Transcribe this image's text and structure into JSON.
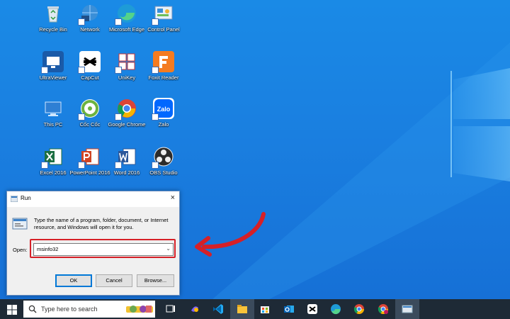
{
  "desktop": {
    "icons": [
      {
        "label": "Recycle Bin",
        "icon": "recycle-bin-icon"
      },
      {
        "label": "Network",
        "icon": "network-icon"
      },
      {
        "label": "Microsoft Edge",
        "icon": "edge-icon"
      },
      {
        "label": "Control Panel",
        "icon": "control-panel-icon"
      },
      {
        "label": "UltraViewer",
        "icon": "ultraviewer-icon"
      },
      {
        "label": "CapCut",
        "icon": "capcut-icon"
      },
      {
        "label": "UniKey",
        "icon": "unikey-icon"
      },
      {
        "label": "Foxit Reader",
        "icon": "foxit-reader-icon"
      },
      {
        "label": "This PC",
        "icon": "this-pc-icon"
      },
      {
        "label": "Cốc Cốc",
        "icon": "coc-coc-icon"
      },
      {
        "label": "Google Chrome",
        "icon": "chrome-icon"
      },
      {
        "label": "Zalo",
        "icon": "zalo-icon"
      },
      {
        "label": "Excel 2016",
        "icon": "excel-icon"
      },
      {
        "label": "PowerPoint 2016",
        "icon": "powerpoint-icon"
      },
      {
        "label": "Word 2016",
        "icon": "word-icon"
      },
      {
        "label": "OBS Studio",
        "icon": "obs-icon"
      }
    ]
  },
  "run_dialog": {
    "title": "Run",
    "close": "×",
    "description": "Type the name of a program, folder, document, or Internet resource, and Windows will open it for you.",
    "open_label": "Open:",
    "open_value": "msinfo32",
    "ok": "OK",
    "cancel": "Cancel",
    "browse": "Browse..."
  },
  "taskbar": {
    "search_placeholder": "Type here to search",
    "apps": [
      "task-view-icon",
      "copilot-icon",
      "vscode-icon",
      "file-explorer-icon",
      "store-icon",
      "outlook-icon",
      "capcut-icon",
      "edge-icon",
      "chrome-icon",
      "chrome-profile-icon",
      "run-icon"
    ]
  },
  "colors": {
    "desktop": "#1a7fe0",
    "taskbar": "#1e2a36",
    "highlight": "#d62027"
  }
}
